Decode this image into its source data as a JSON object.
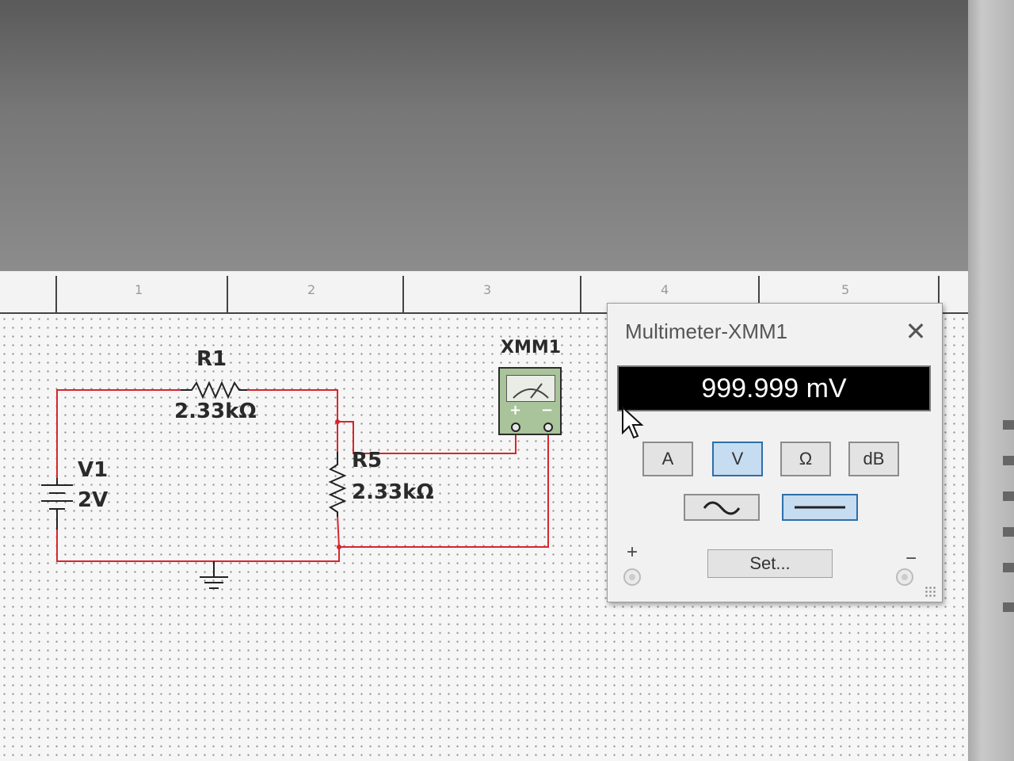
{
  "ruler": {
    "marks": [
      "1",
      "2",
      "3",
      "4",
      "5"
    ]
  },
  "schematic": {
    "r1": {
      "name": "R1",
      "value": "2.33kΩ"
    },
    "r5": {
      "name": "R5",
      "value": "2.33kΩ"
    },
    "v1": {
      "name": "V1",
      "value": "2V"
    },
    "xmm": {
      "name": "XMM1",
      "plus": "+",
      "minus": "−"
    }
  },
  "multimeter_window": {
    "title": "Multimeter-XMM1",
    "reading": "999.999 mV",
    "modes": [
      "A",
      "V",
      "Ω",
      "dB"
    ],
    "active_mode": "V",
    "signal_modes": [
      "ac",
      "dc"
    ],
    "active_signal": "dc",
    "set_label": "Set...",
    "plus_label": "+",
    "minus_label": "−"
  },
  "colors": {
    "wire": "#d9242b",
    "display_bg": "#000000",
    "active_button": "#2e6ea8"
  }
}
